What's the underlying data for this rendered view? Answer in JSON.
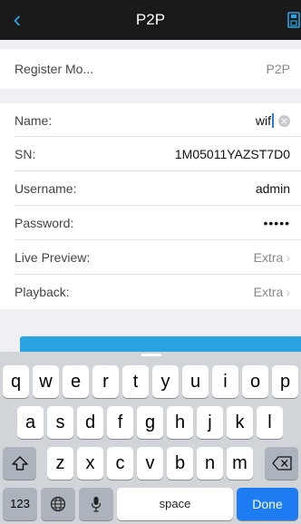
{
  "nav": {
    "title": "P2P",
    "back_icon": "chevron-left-icon",
    "save_icon": "save-icon"
  },
  "rows": {
    "register": {
      "label": "Register Mo...",
      "value": "P2P"
    },
    "name": {
      "label": "Name:",
      "value": "wif"
    },
    "sn": {
      "label": "SN:",
      "value": "1M05011YAZST7D0"
    },
    "username": {
      "label": "Username:",
      "value": "admin"
    },
    "password": {
      "label": "Password:",
      "value": "•••••"
    },
    "live_preview": {
      "label": "Live Preview:",
      "value": "Extra"
    },
    "playback": {
      "label": "Playback:",
      "value": "Extra"
    }
  },
  "keyboard": {
    "row1": [
      "q",
      "w",
      "e",
      "r",
      "t",
      "y",
      "u",
      "i",
      "o",
      "p"
    ],
    "row2": [
      "a",
      "s",
      "d",
      "f",
      "g",
      "h",
      "j",
      "k",
      "l"
    ],
    "row3": [
      "z",
      "x",
      "c",
      "v",
      "b",
      "n",
      "m"
    ],
    "numbers_key": "123",
    "space_key": "space",
    "done_key": "Done",
    "icons": [
      "shift-icon",
      "backspace-icon",
      "globe-icon",
      "microphone-icon"
    ]
  },
  "colors": {
    "accent": "#2aa4e0",
    "navbar": "#1a1a1a",
    "done": "#1e7cf2"
  }
}
